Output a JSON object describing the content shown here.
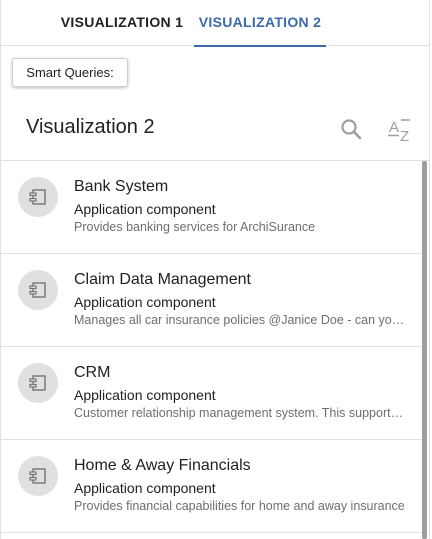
{
  "tabs": [
    {
      "label": "VISUALIZATION 1",
      "active": false
    },
    {
      "label": "VISUALIZATION 2",
      "active": true
    }
  ],
  "smart_queries": {
    "label": "Smart Queries:"
  },
  "header": {
    "title": "Visualization 2",
    "icons": [
      "search-icon",
      "sort-alpha-icon"
    ],
    "sort_icon_text": {
      "a": "A",
      "z": "Z"
    }
  },
  "items": [
    {
      "name": "Bank System",
      "type": "Application component",
      "description": "Provides banking services for ArchiSurance",
      "icon": "application-component-icon"
    },
    {
      "name": "Claim Data Management",
      "type": "Application component",
      "description": "Manages all car insurance policies @Janice Doe - can you please check this",
      "icon": "application-component-icon"
    },
    {
      "name": "CRM",
      "type": "Application component",
      "description": "Customer relationship management system. This supports the front office",
      "icon": "application-component-icon"
    },
    {
      "name": "Home & Away Financials",
      "type": "Application component",
      "description": "Provides financial capabilities for home and away insurance",
      "icon": "application-component-icon"
    }
  ],
  "colors": {
    "accent": "#3a6aa8",
    "avatar_bg": "#e0e0e0",
    "icon_gray": "#9e9e9e"
  }
}
